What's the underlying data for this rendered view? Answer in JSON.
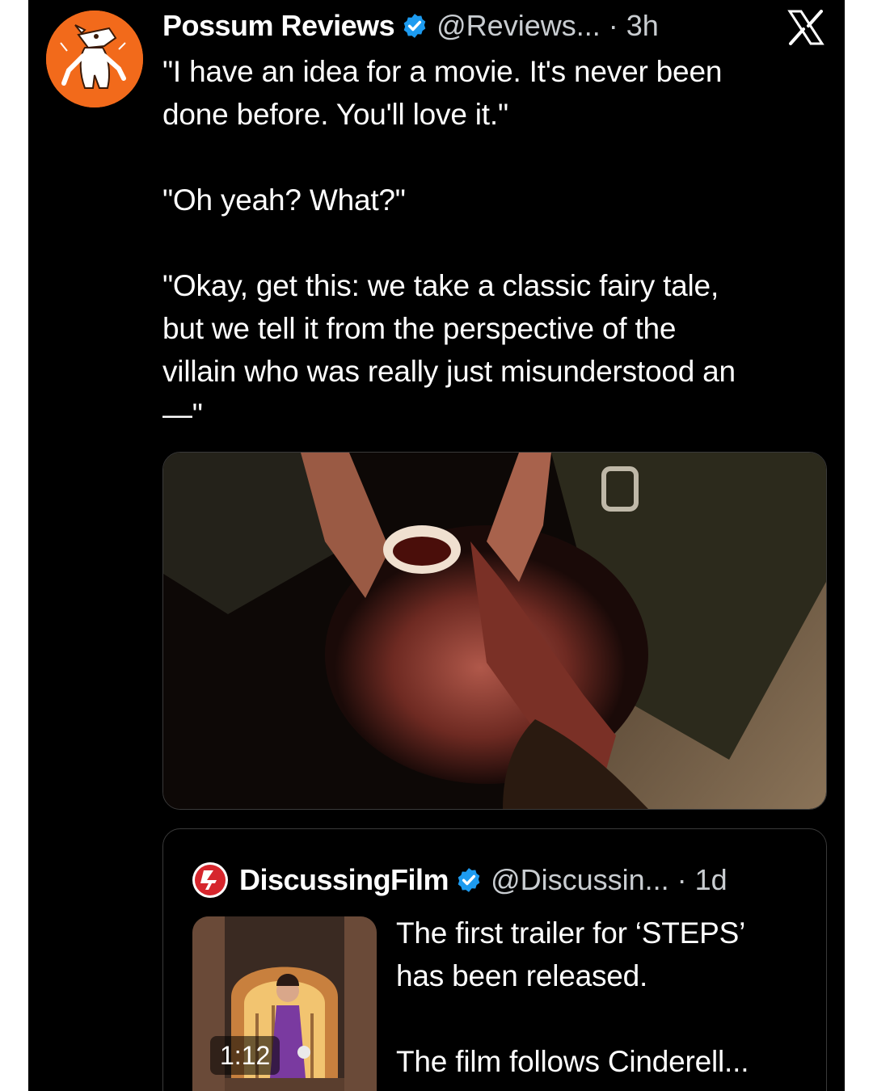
{
  "tweet": {
    "author_name": "Possum Reviews",
    "handle_time": "@Reviews... · 3h",
    "platform_logo": "x-logo",
    "text_lines": [
      "\"I have an idea for a movie. It's never been",
      "done before. You'll love it.\"",
      "\"Oh yeah? What?\"",
      "\"Okay, get this: we take a classic fairy tale,",
      "but we tell it from the perspective of the",
      "villain who was really just misunderstood an",
      "—\""
    ],
    "avatar_color": "#f26a1b",
    "verified_color": "#1d9bf0"
  },
  "quote": {
    "author_name": "DiscussingFilm",
    "handle_time": "@Discussin... · 1d",
    "logo_color": "#d6262d",
    "video_duration": "1:12",
    "text_lines": [
      "The first trailer for ‘STEPS’",
      "has been released.",
      "The film follows Cinderell..."
    ]
  }
}
